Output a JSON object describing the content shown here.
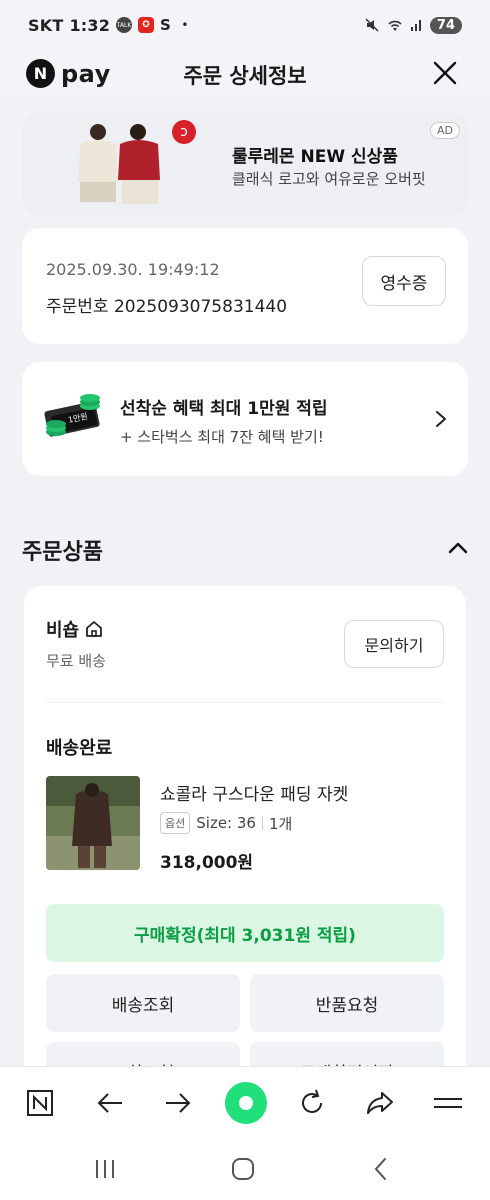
{
  "status_bar": {
    "carrier": "SKT",
    "time": "1:32",
    "talk_label": "TALK",
    "s_label": "S",
    "battery": "74"
  },
  "header": {
    "logo_letter": "N",
    "logo_text": "pay",
    "title": "주문 상세정보"
  },
  "ad": {
    "title": "룰루레몬 NEW 신상품",
    "subtitle": "클래식 로고와 여유로운 오버핏",
    "badge": "AD"
  },
  "order": {
    "datetime": "2025.09.30. 19:49:12",
    "number_label": "주문번호",
    "number": "2025093075831440",
    "receipt_label": "영수증"
  },
  "promo": {
    "title": "선착순 혜택 최대 1만원 적립",
    "subtitle": "+ 스타벅스 최대 7잔 혜택 받기!"
  },
  "section": {
    "title": "주문상품"
  },
  "seller": {
    "name": "비숍",
    "shipping": "무료 배송",
    "inquiry_label": "문의하기"
  },
  "product": {
    "delivery_status": "배송완료",
    "name": "쇼콜라 구스다운 패딩 자켓",
    "option_badge": "옵션",
    "option_size": "Size: 36",
    "quantity": "1개",
    "price": "318,000원"
  },
  "actions": {
    "confirm": "구매확정(최대 3,031원 적립)",
    "track": "배송조회",
    "return": "반품요청",
    "exchange": "교환요청",
    "cancel_confirm": "구매확정연장"
  },
  "colors": {
    "accent_green": "#0b9e43",
    "confirm_bg": "#dbf7e4",
    "page_bg": "#f0f2f6"
  }
}
